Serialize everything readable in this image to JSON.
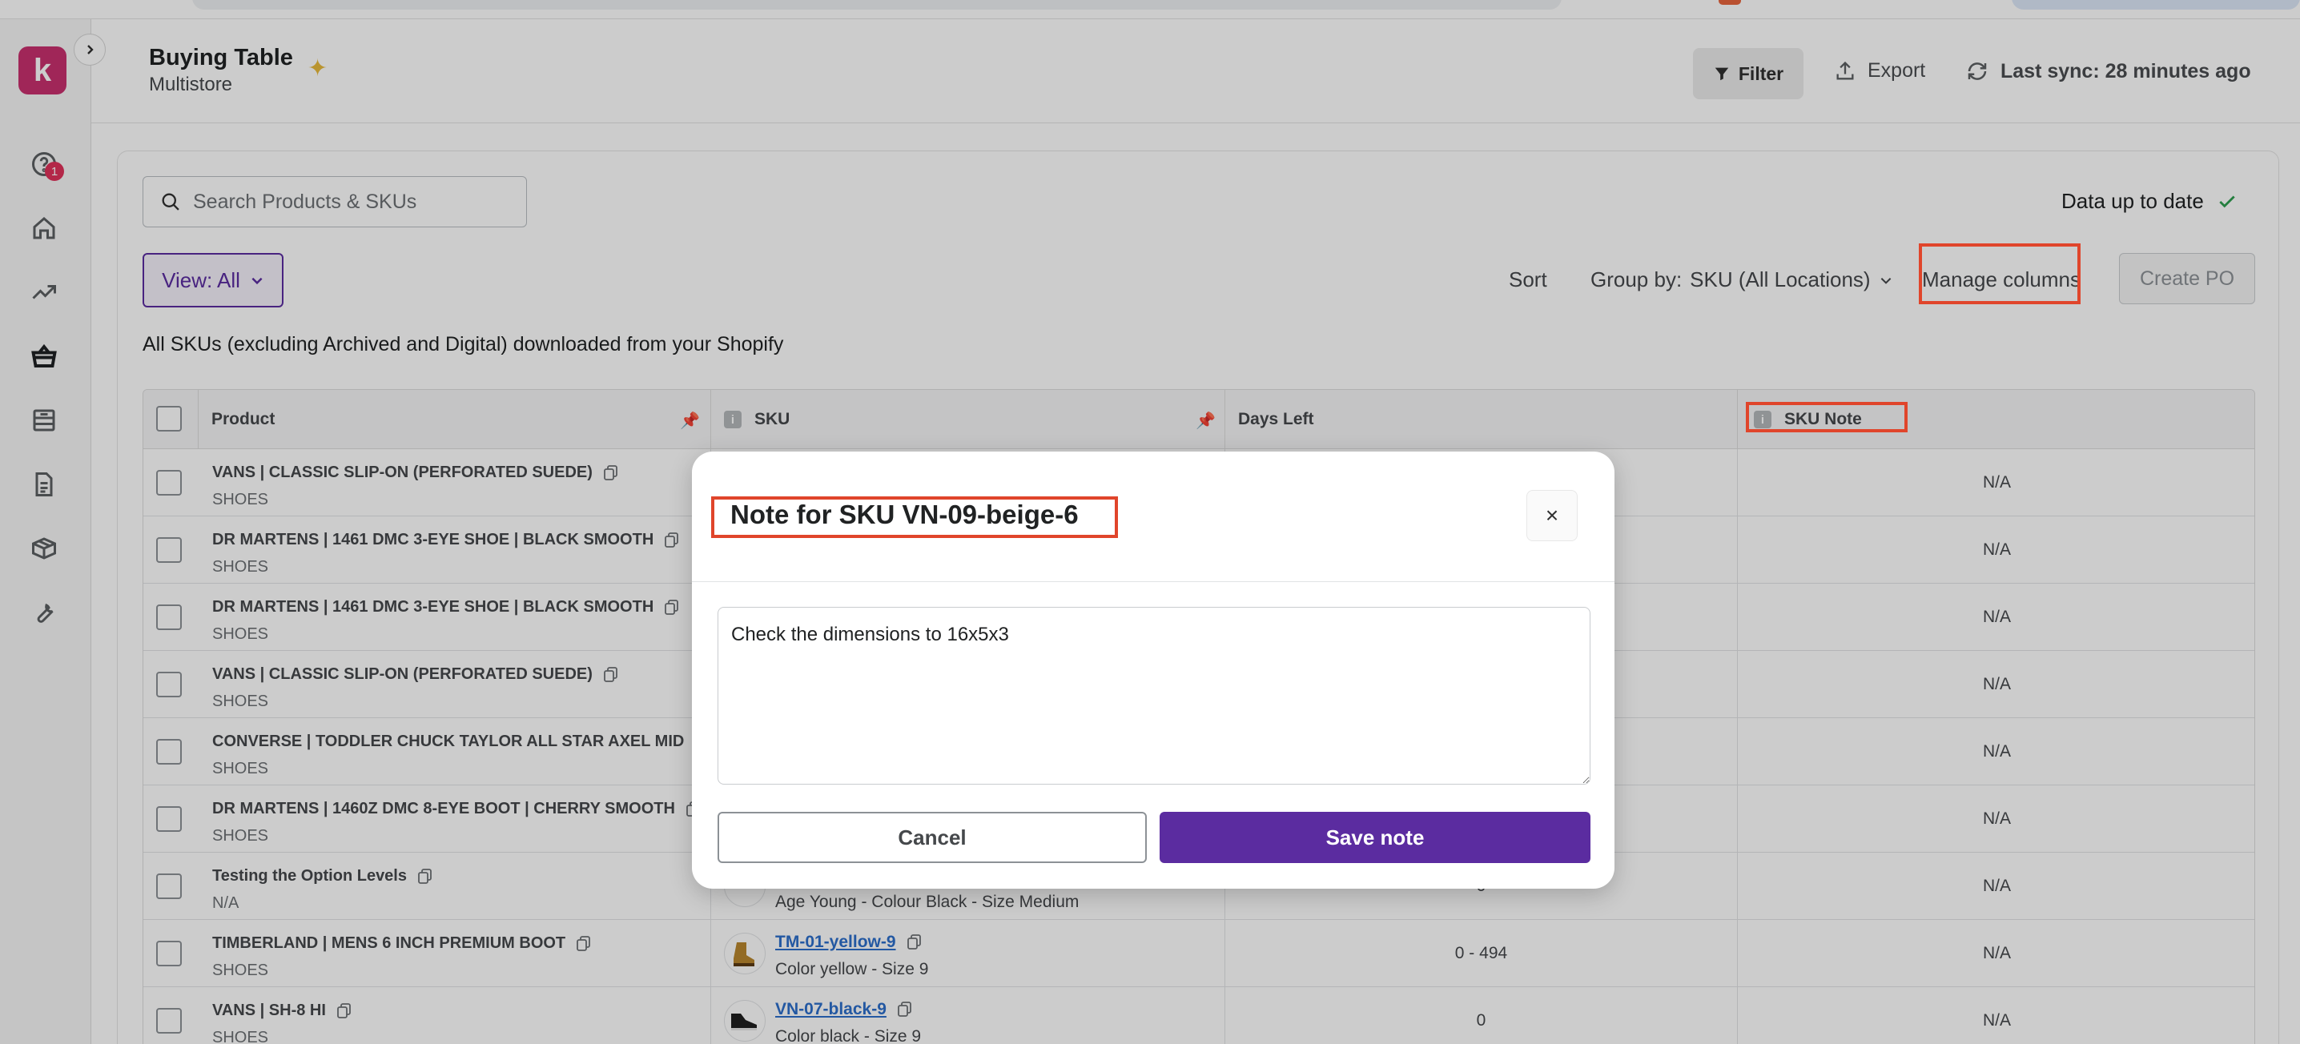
{
  "header": {
    "title": "Buying Table",
    "subtitle": "Multistore",
    "filter_label": "Filter",
    "export_label": "Export",
    "sync_label": "Last sync: 28 minutes ago"
  },
  "sidebar": {
    "logo_letter": "k",
    "help_badge": "1",
    "icons": [
      "help-icon",
      "home-icon",
      "trending-icon",
      "basket-icon",
      "inventory-icon",
      "document-icon",
      "box-icon",
      "wrench-icon"
    ]
  },
  "toolbar": {
    "search_placeholder": "Search Products & SKUs",
    "data_status": "Data up to date",
    "view_label": "View: All",
    "sort_label": "Sort",
    "groupby_prefix": "Group by:",
    "groupby_value": "SKU (All Locations)",
    "manage_columns_label": "Manage columns",
    "create_po_label": "Create PO",
    "description": "All SKUs (excluding Archived and Digital) downloaded from your Shopify"
  },
  "table": {
    "columns": {
      "product": "Product",
      "sku": "SKU",
      "days_left": "Days Left",
      "sku_note": "SKU Note"
    },
    "rows": [
      {
        "product": "VANS | CLASSIC SLIP-ON (PERFORATED SUEDE)",
        "category": "SHOES",
        "sku": "",
        "variant": "",
        "days_left": "",
        "note": "N/A"
      },
      {
        "product": "DR MARTENS | 1461 DMC 3-EYE SHOE | BLACK SMOOTH",
        "category": "SHOES",
        "sku": "",
        "variant": "",
        "days_left": "",
        "note": "N/A"
      },
      {
        "product": "DR MARTENS | 1461 DMC 3-EYE SHOE | BLACK SMOOTH",
        "category": "SHOES",
        "sku": "",
        "variant": "",
        "days_left": "",
        "note": "N/A"
      },
      {
        "product": "VANS | CLASSIC SLIP-ON (PERFORATED SUEDE)",
        "category": "SHOES",
        "sku": "",
        "variant": "",
        "days_left": "",
        "note": "N/A"
      },
      {
        "product": "CONVERSE | TODDLER CHUCK TAYLOR ALL STAR AXEL MID",
        "category": "SHOES",
        "sku": "",
        "variant": "",
        "days_left": "",
        "note": "N/A"
      },
      {
        "product": "DR MARTENS | 1460Z DMC 8-EYE BOOT | CHERRY SMOOTH",
        "category": "SHOES",
        "sku": "",
        "variant": "",
        "days_left": "",
        "note": "N/A"
      },
      {
        "product": "Testing the Option Levels",
        "category": "N/A",
        "sku": "",
        "variant": "Age Young - Colour Black - Size Medium",
        "days_left": "0",
        "note": "N/A"
      },
      {
        "product": "TIMBERLAND | MENS 6 INCH PREMIUM BOOT",
        "category": "SHOES",
        "sku": "TM-01-yellow-9",
        "variant": "Color yellow - Size 9",
        "days_left": "0 - 494",
        "note": "N/A"
      },
      {
        "product": "VANS | SH-8 HI",
        "category": "SHOES",
        "sku": "VN-07-black-9",
        "variant": "Color black - Size 9",
        "days_left": "0",
        "note": "N/A"
      }
    ]
  },
  "modal": {
    "title": "Note for SKU VN-09-beige-6",
    "note_text": "Check the dimensions to 16x5x3",
    "cancel_label": "Cancel",
    "save_label": "Save note",
    "close_symbol": "×"
  },
  "colors": {
    "brand": "#5b2ca0",
    "logo": "#c8306e",
    "annotation": "#e0452b",
    "link": "#2c6ecb",
    "success": "#2e9e4f"
  }
}
